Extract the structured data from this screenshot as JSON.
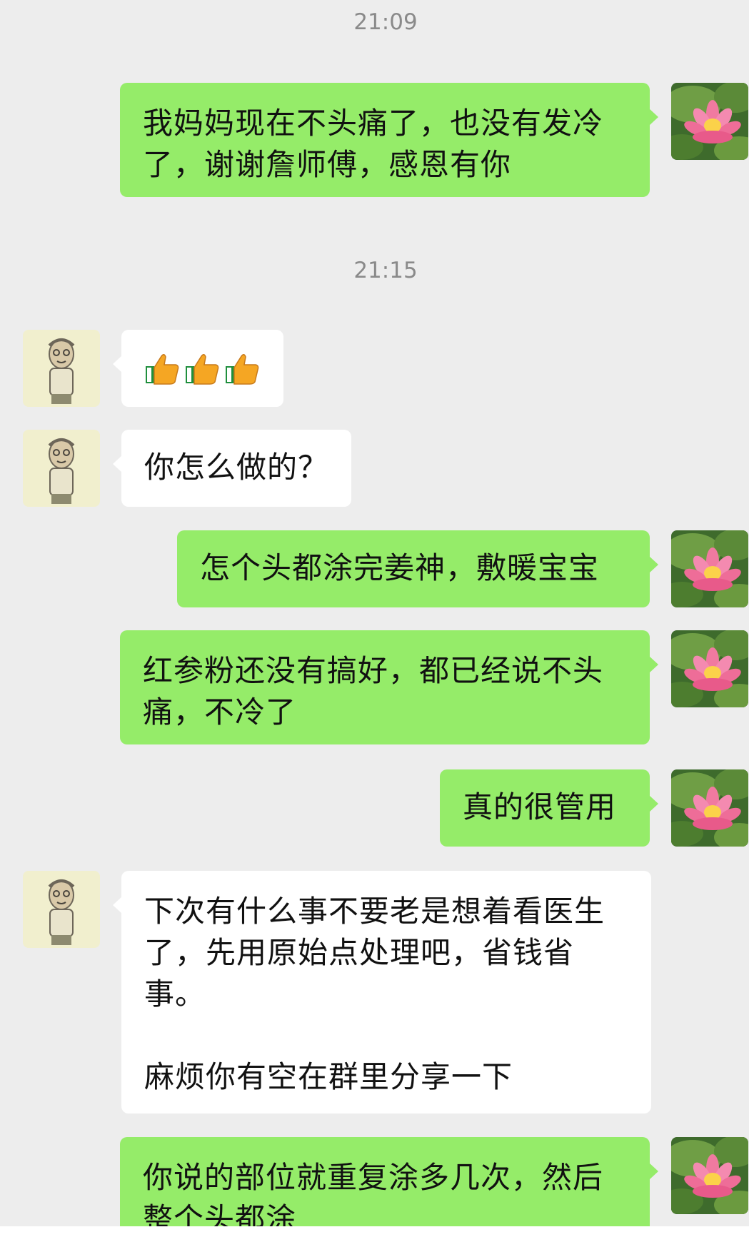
{
  "chat": {
    "timestamps": [
      "21:09",
      "21:15"
    ],
    "messages": [
      {
        "sender": "me",
        "lines": [
          "我妈妈现在不头痛了，也没有发冷",
          "了，谢谢詹师傅，感恩有你"
        ]
      },
      {
        "sender": "other",
        "emoji": [
          "thumbs-up",
          "thumbs-up",
          "thumbs-up"
        ]
      },
      {
        "sender": "other",
        "lines": [
          "你怎么做的？"
        ]
      },
      {
        "sender": "me",
        "lines": [
          "怎个头都涂完姜神，敷暖宝宝"
        ]
      },
      {
        "sender": "me",
        "lines": [
          "红参粉还没有搞好，都已经说不头",
          "痛，不冷了"
        ]
      },
      {
        "sender": "me",
        "lines": [
          "真的很管用"
        ]
      },
      {
        "sender": "other",
        "lines": [
          "下次有什么事不要老是想着看医生",
          "了，先用原始点处理吧，省钱省",
          "事。",
          "麻烦你有空在群里分享一下"
        ]
      },
      {
        "sender": "me",
        "lines": [
          "你说的部位就重复涂多几次，然后",
          "整个头都涂"
        ]
      }
    ]
  },
  "avatars": {
    "me": "lotus-flower-avatar",
    "other": "cartoon-man-avatar"
  },
  "colors": {
    "background": "#ededed",
    "my_bubble": "#95ec69",
    "other_bubble": "#ffffff",
    "timestamp": "#8a8a8a"
  }
}
